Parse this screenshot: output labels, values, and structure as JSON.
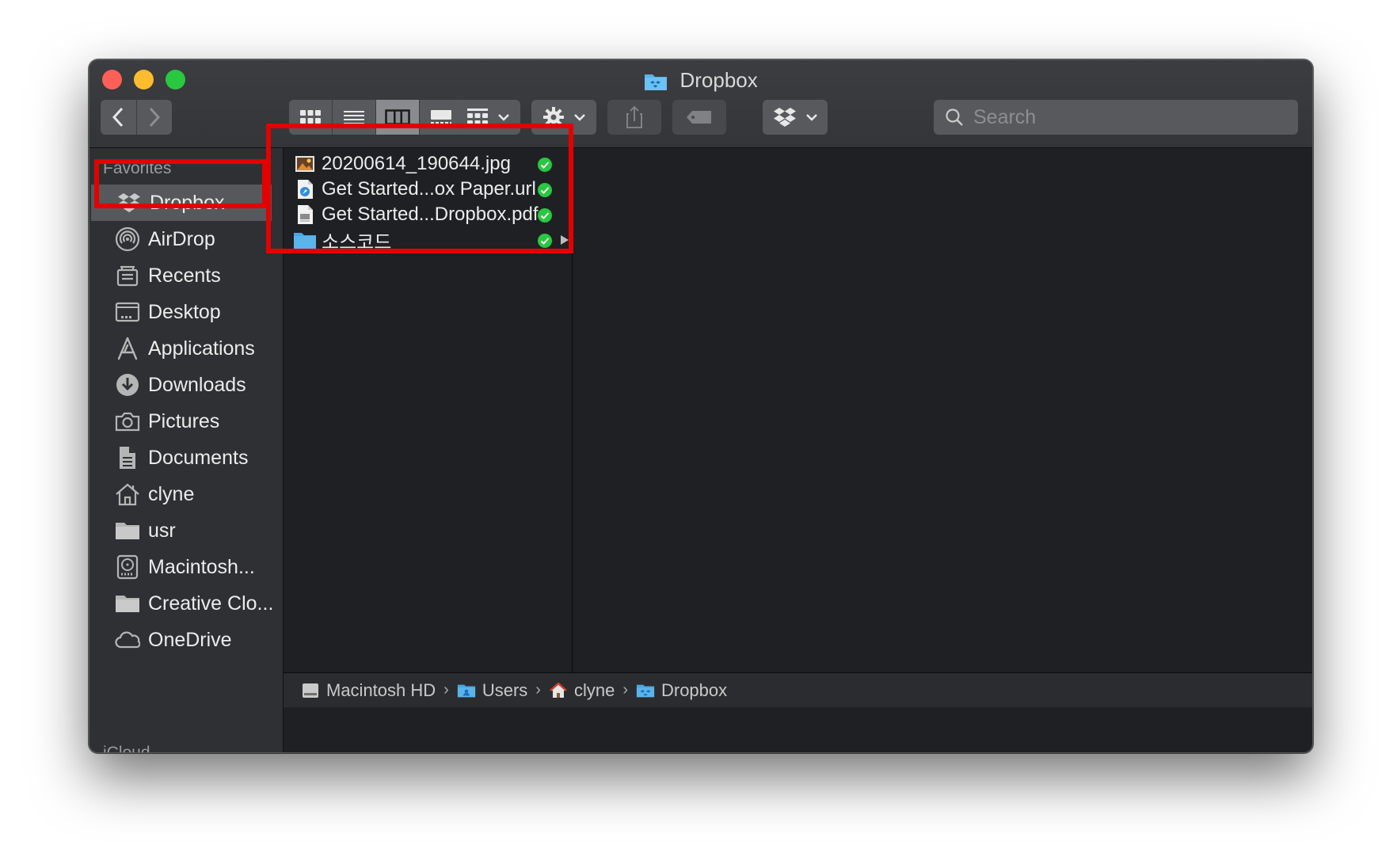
{
  "window": {
    "title": "Dropbox"
  },
  "toolbar": {
    "back_label": "Back",
    "forward_label": "Forward",
    "search_placeholder": "Search"
  },
  "sidebar": {
    "header": "Favorites",
    "items": [
      {
        "label": "Dropbox",
        "icon": "dropbox-icon",
        "selected": true
      },
      {
        "label": "AirDrop",
        "icon": "airdrop-icon"
      },
      {
        "label": "Recents",
        "icon": "recents-icon"
      },
      {
        "label": "Desktop",
        "icon": "desktop-icon"
      },
      {
        "label": "Applications",
        "icon": "applications-icon"
      },
      {
        "label": "Downloads",
        "icon": "downloads-icon"
      },
      {
        "label": "Pictures",
        "icon": "pictures-icon"
      },
      {
        "label": "Documents",
        "icon": "documents-icon"
      },
      {
        "label": "clyne",
        "icon": "home-icon"
      },
      {
        "label": "usr",
        "icon": "folder-icon"
      },
      {
        "label": "Macintosh...",
        "icon": "hard-drive-icon"
      },
      {
        "label": "Creative Clo...",
        "icon": "folder-icon"
      },
      {
        "label": "OneDrive",
        "icon": "cloud-icon"
      }
    ],
    "next_header": "iCloud"
  },
  "files": [
    {
      "name": "20200614_190644.jpg",
      "icon": "image-file-icon",
      "synced": true
    },
    {
      "name": "Get Started...ox Paper.url",
      "icon": "url-file-icon",
      "synced": true
    },
    {
      "name": "Get Started...Dropbox.pdf",
      "icon": "pdf-file-icon",
      "synced": true
    },
    {
      "name": "소스코드",
      "icon": "folder-icon",
      "synced": true,
      "has_children": true
    }
  ],
  "pathbar": [
    {
      "label": "Macintosh HD",
      "icon": "hard-drive-icon"
    },
    {
      "label": "Users",
      "icon": "users-folder-icon"
    },
    {
      "label": "clyne",
      "icon": "home-icon"
    },
    {
      "label": "Dropbox",
      "icon": "dropbox-folder-icon"
    }
  ],
  "colors": {
    "highlight": "#e40000",
    "sync_check": "#28c840",
    "folder_blue": "#5ab4ea"
  }
}
